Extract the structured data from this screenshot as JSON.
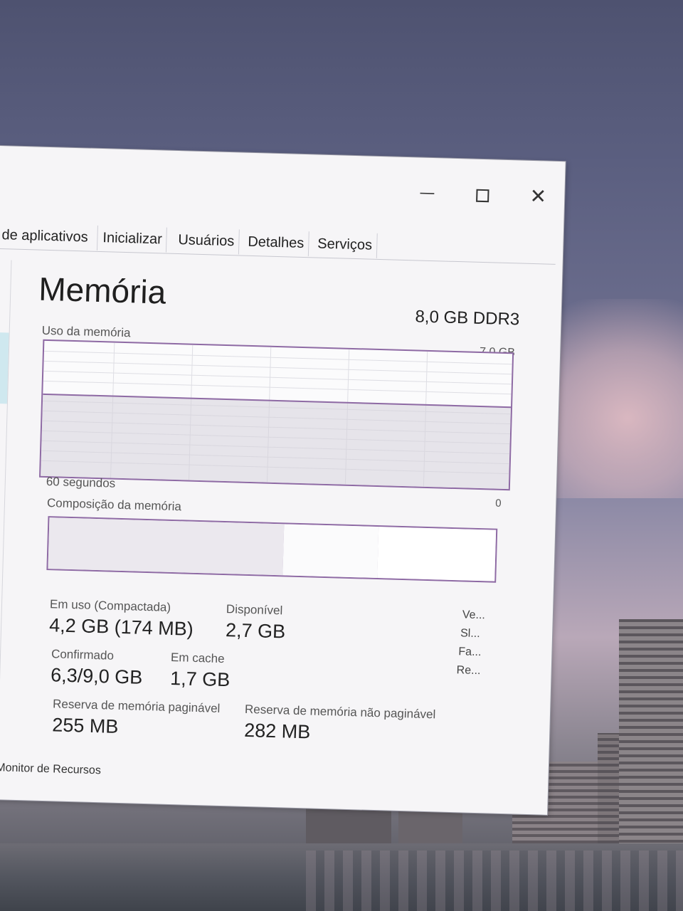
{
  "window": {
    "controls": {
      "minimize": "—",
      "maximize": "",
      "close": "✕"
    },
    "tabs": [
      "de aplicativos",
      "Inicializar",
      "Usuários",
      "Detalhes",
      "Serviços"
    ]
  },
  "memory": {
    "title": "Memória",
    "spec": "8,0 GB DDR3",
    "usage_label": "Uso da memória",
    "usage_max": "7,0 GB",
    "time_label": "60 segundos",
    "zero_label": "0",
    "composition_label": "Composição da memória",
    "usage_fraction": 0.6,
    "stats": {
      "in_use_label": "Em uso (Compactada)",
      "in_use_value": "4,2 GB (174 MB)",
      "available_label": "Disponível",
      "available_value": "2,7 GB",
      "committed_label": "Confirmado",
      "committed_value": "6,3/9,0 GB",
      "cached_label": "Em cache",
      "cached_value": "1,7 GB",
      "paged_label": "Reserva de memória paginável",
      "paged_value": "255 MB",
      "nonpaged_label": "Reserva de memória não paginável",
      "nonpaged_value": "282 MB"
    },
    "side_labels": [
      "Ve...",
      "Sl...",
      "Fa...",
      "Re..."
    ]
  },
  "sidebar": {
    "more": "..."
  },
  "footer": {
    "resource_monitor_link": "rir Monitor de Recursos"
  },
  "colors": {
    "accent": "#8e6aa4",
    "selection": "#cfe8ef"
  }
}
